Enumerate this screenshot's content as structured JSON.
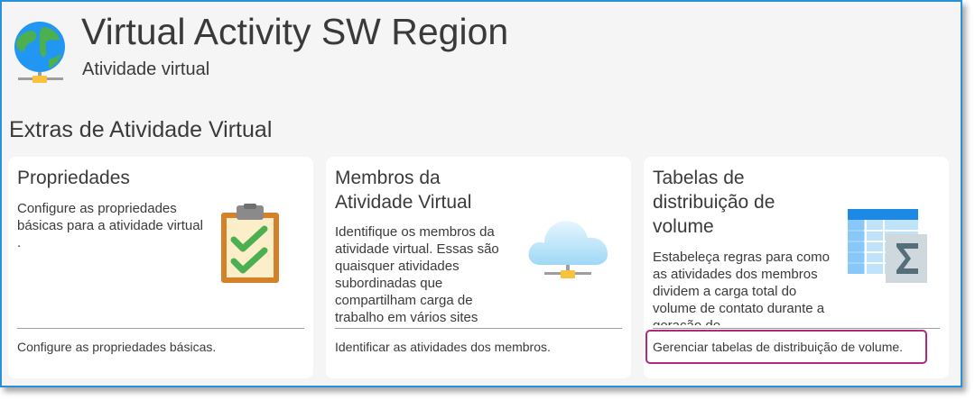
{
  "header": {
    "title": "Virtual Activity SW Region",
    "subtitle": "Atividade virtual",
    "icon": "globe-network-icon"
  },
  "section": {
    "title": "Extras de Atividade Virtual"
  },
  "cards": [
    {
      "title": "Propriedades",
      "description": "Configure as propriedades básicas para a atividade virtual .",
      "action": "Configure as propriedades básicas.",
      "icon": "clipboard-checklist-icon"
    },
    {
      "title": "Membros da Atividade Virtual",
      "description": "Identifique os membros da atividade virtual. Essas são quaisquer atividades subordinadas que compartilham carga de trabalho em vários sites",
      "action": "Identificar as atividades dos membros.",
      "icon": "cloud-network-icon"
    },
    {
      "title": "Tabelas de distribuição de volume",
      "description": "Estabeleça regras para como as atividades dos membros dividem a carga total do volume de contato durante a geração de",
      "action": "Gerenciar tabelas de distribuição de volume.",
      "icon": "table-sigma-icon"
    }
  ],
  "colors": {
    "frame_border": "#2b90d9",
    "highlight": "#b0297b",
    "card_bg": "#ffffff",
    "page_bg": "#f5f5f5"
  }
}
